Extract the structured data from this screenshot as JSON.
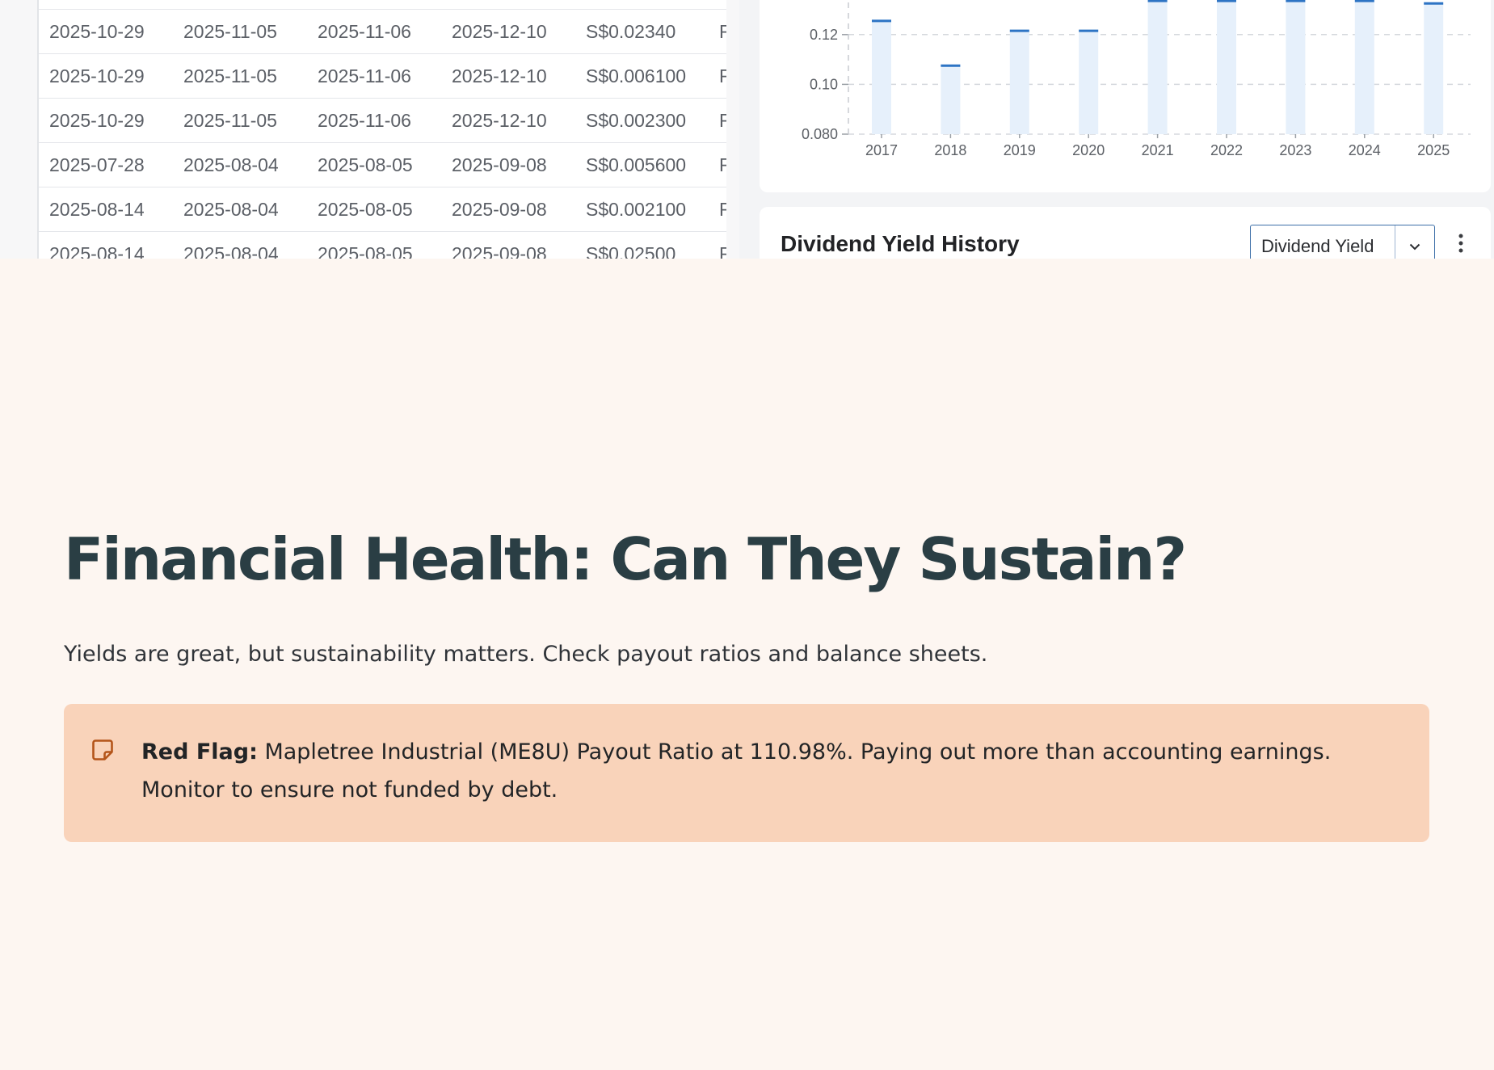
{
  "dividends_table": {
    "rows": [
      [
        "2025-10-29",
        "2025-11-05",
        "2025-11-06",
        "2025-12-10",
        "S$0.02340",
        "F"
      ],
      [
        "2025-10-29",
        "2025-11-05",
        "2025-11-06",
        "2025-12-10",
        "S$0.006100",
        "F"
      ],
      [
        "2025-10-29",
        "2025-11-05",
        "2025-11-06",
        "2025-12-10",
        "S$0.002300",
        "F"
      ],
      [
        "2025-07-28",
        "2025-08-04",
        "2025-08-05",
        "2025-09-08",
        "S$0.005600",
        "F"
      ],
      [
        "2025-08-14",
        "2025-08-04",
        "2025-08-05",
        "2025-09-08",
        "S$0.002100",
        "F"
      ],
      [
        "2025-08-14",
        "2025-08-04",
        "2025-08-05",
        "2025-09-08",
        "S$0.02500",
        "F"
      ]
    ]
  },
  "chart_data": {
    "type": "bar",
    "categories": [
      "2017",
      "2018",
      "2019",
      "2020",
      "2021",
      "2022",
      "2023",
      "2024",
      "2025"
    ],
    "values": [
      0.126,
      0.108,
      0.122,
      0.122,
      0.134,
      0.134,
      0.134,
      0.134,
      0.133
    ],
    "y_ticks": [
      "0.080",
      "0.10",
      "0.12"
    ],
    "ylim": [
      0.08,
      0.128
    ],
    "grid": true,
    "colors": {
      "bar_fill": "#E6F0FB",
      "bar_cap": "#2D74C4",
      "grid": "#D5D8DD",
      "text": "#5C6066"
    }
  },
  "dividend_yield_panel": {
    "title": "Dividend Yield History",
    "selector_value": "Dividend Yield",
    "chevron_icon": "chevron-down-icon",
    "menu_icon": "more-vertical-icon"
  },
  "article": {
    "heading": "Financial Health: Can They Sustain?",
    "lead": "Yields are great, but sustainability matters. Check payout ratios and balance sheets.",
    "callout": {
      "icon": "note-icon",
      "label": "Red Flag:",
      "text": " Mapletree Industrial (ME8U) Payout Ratio at 110.98%. Paying out more than accounting earnings. Monitor to ensure not funded by debt.",
      "colors": {
        "background": "#F9D3BA",
        "icon": "#B4551A"
      }
    }
  },
  "colors": {
    "page_background": "#FDF6F1",
    "heading": "#2A3E44"
  }
}
